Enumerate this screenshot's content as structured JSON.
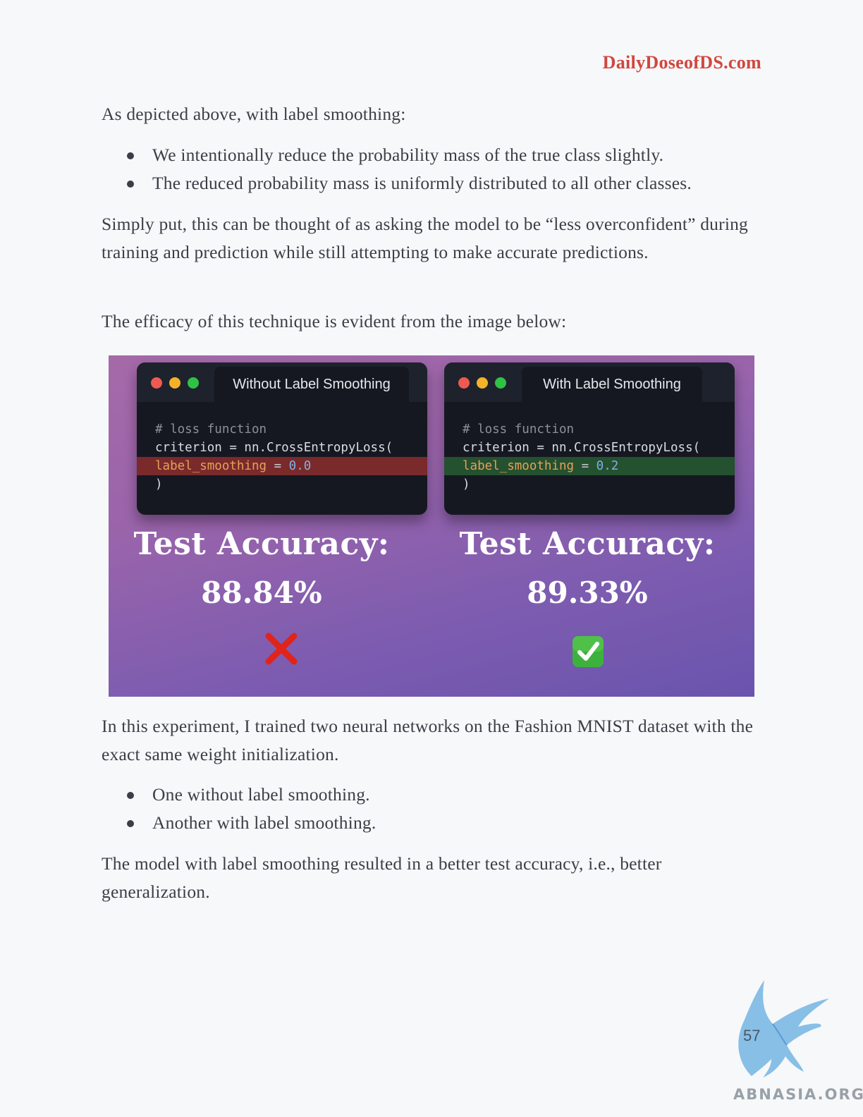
{
  "header": {
    "site": "DailyDoseofDS.com"
  },
  "intro": "As depicted above, with label smoothing:",
  "bullets1": [
    "We intentionally reduce the probability mass of the true class slightly.",
    "The reduced probability mass is uniformly distributed to all other classes."
  ],
  "para2": "Simply put, this can be thought of as asking the model to be “less overconfident” during training and prediction while still attempting to make accurate predictions.",
  "para3": "The efficacy of this technique is evident from the image below:",
  "figure": {
    "left": {
      "tab": "Without Label Smoothing",
      "comment": "# loss function",
      "line2": "criterion = nn.CrossEntropyLoss(",
      "arg": "label_smoothing",
      "eq": " = ",
      "value": "0.0",
      "close": ")",
      "acc_label": "Test Accuracy:",
      "acc_value": "88.84%",
      "mark": "cross-mark"
    },
    "right": {
      "tab": "With Label Smoothing",
      "comment": "# loss function",
      "line2": "criterion = nn.CrossEntropyLoss(",
      "arg": "label_smoothing",
      "eq": " = ",
      "value": "0.2",
      "close": ")",
      "acc_label": "Test Accuracy:",
      "acc_value": "89.33%",
      "mark": "check-mark"
    }
  },
  "para4": "In this experiment, I trained two neural networks on the Fashion MNIST dataset with the exact same weight initialization.",
  "bullets2": [
    "One without label smoothing.",
    "Another with label smoothing."
  ],
  "para5": "The model with label smoothing resulted in a better test accuracy, i.e., better generalization.",
  "footer": {
    "page": "57",
    "watermark": "ABNASIA.ORG"
  }
}
